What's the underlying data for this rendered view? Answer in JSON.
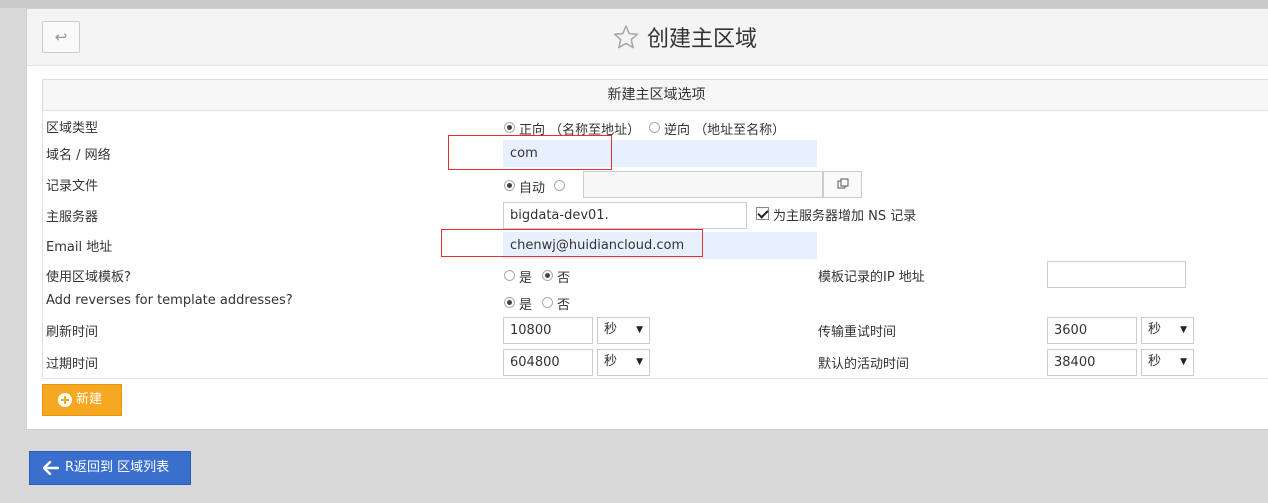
{
  "header": {
    "back_icon": "undo-arrow-icon",
    "title_icon": "star-outline-icon",
    "title": "创建主区域"
  },
  "section": {
    "title": "新建主区域选项"
  },
  "form": {
    "zone_type": {
      "label": "区域类型",
      "opt_forward": "正向 （名称至地址）",
      "opt_reverse": "逆向 （地址至名称）",
      "selected": "forward"
    },
    "domain": {
      "label": "域名 / 网络",
      "value": "com"
    },
    "record_file": {
      "label": "记录文件",
      "opt_auto": "自动",
      "value": ""
    },
    "master_server": {
      "label": "主服务器",
      "value": "bigdata-dev01.",
      "ns_checkbox_label": "为主服务器增加 NS 记录",
      "ns_checked": true
    },
    "email": {
      "label": "Email 地址",
      "value": "chenwj@huidiancloud.com"
    },
    "use_template": {
      "label": "使用区域模板?",
      "opt_yes": "是",
      "opt_no": "否",
      "selected": "no"
    },
    "template_ip": {
      "label": "模板记录的IP 地址",
      "value": ""
    },
    "add_reverses": {
      "label": "Add reverses for template addresses?",
      "opt_yes": "是",
      "opt_no": "否",
      "selected": "yes"
    },
    "refresh": {
      "label": "刷新时间",
      "value": "10800",
      "unit": "秒"
    },
    "retry": {
      "label": "传输重试时间",
      "value": "3600",
      "unit": "秒"
    },
    "expire": {
      "label": "过期时间",
      "value": "604800",
      "unit": "秒"
    },
    "default_ttl": {
      "label": "默认的活动时间",
      "value": "38400",
      "unit": "秒"
    }
  },
  "buttons": {
    "create": "新建",
    "return": "R返回到 区域列表"
  },
  "colors": {
    "create_button": "#f6a821",
    "return_button": "#3a6fcd",
    "highlight_input": "#e8efff",
    "annotation_box": "#e03030"
  }
}
